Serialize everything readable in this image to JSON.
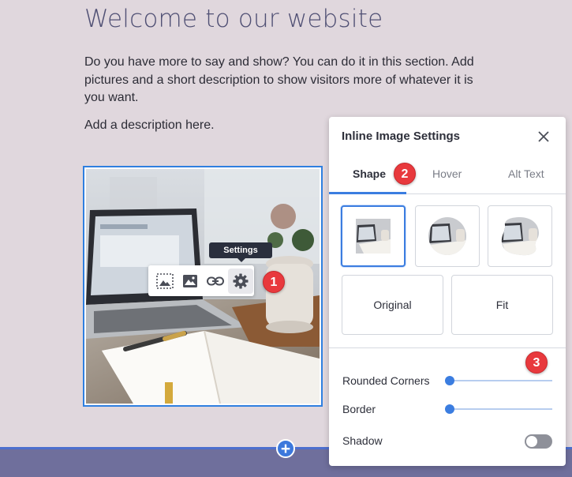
{
  "page": {
    "title": "Welcome to our website",
    "paragraph": "Do you have more to say and show? You can do it in this section. Add pictures and a short description to show visitors more of whatever it is you want.",
    "description": "Add a description here."
  },
  "image_toolbar": {
    "tooltip": "Settings",
    "buttons": [
      {
        "icon": "crop-icon"
      },
      {
        "icon": "replace-image-icon"
      },
      {
        "icon": "link-icon"
      },
      {
        "icon": "gear-icon"
      }
    ]
  },
  "add_section": {
    "label": "+"
  },
  "callouts": {
    "one": "1",
    "two": "2",
    "three": "3"
  },
  "settings_panel": {
    "title": "Inline Image Settings",
    "close_icon": "close-icon",
    "tabs": [
      {
        "label": "Shape",
        "active": true
      },
      {
        "label": "Hover",
        "active": false
      },
      {
        "label": "Alt Text",
        "active": false
      }
    ],
    "shapes": [
      {
        "name": "square",
        "selected": true
      },
      {
        "name": "circle",
        "selected": false
      },
      {
        "name": "blob",
        "selected": false
      }
    ],
    "fit_options": [
      {
        "label": "Original"
      },
      {
        "label": "Fit"
      }
    ],
    "controls": {
      "rounded_corners": {
        "label": "Rounded Corners",
        "value": 0
      },
      "border": {
        "label": "Border",
        "value": 0
      },
      "shadow": {
        "label": "Shadow",
        "enabled": false
      }
    }
  },
  "colors": {
    "accent": "#3b7de0",
    "callout": "#e8393d",
    "background": "#e0d7dd",
    "footer": "#6f6f9c"
  }
}
